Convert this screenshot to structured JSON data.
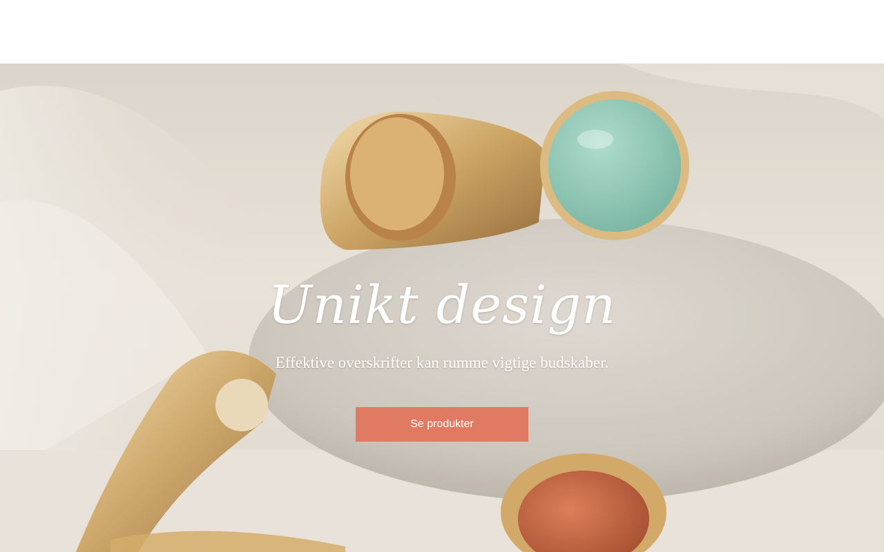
{
  "hero": {
    "title": "Unikt design",
    "subtitle": "Effektive overskrifter kan rumme vigtige budskaber.",
    "button_label": "Se produkter",
    "button_color": "#e07a62"
  }
}
